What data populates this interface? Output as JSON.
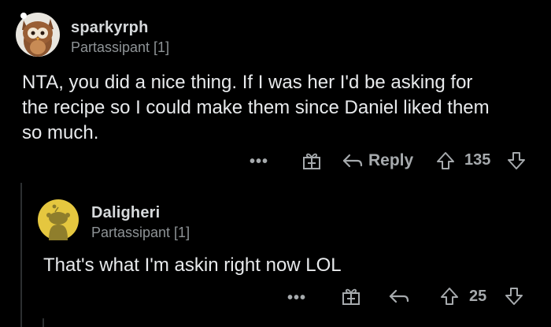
{
  "comments": [
    {
      "username": "sparkyrph",
      "flair": "Partassipant [1]",
      "body_lines": [
        "NTA, you did a nice thing. If I was her I'd be asking for",
        "the recipe so I could make them since Daniel liked them",
        "so much."
      ],
      "actions": {
        "more": "•••",
        "reply": "Reply",
        "score": "135"
      }
    },
    {
      "username": "Daligheri",
      "flair": "Partassipant [1]",
      "body_lines": [
        "That's what I'm askin right now LOL"
      ],
      "actions": {
        "more": "•••",
        "score": "25"
      }
    }
  ],
  "icons": {
    "award": "gift-award-icon",
    "reply": "reply-arrow-icon",
    "upvote": "upvote-arrow-icon",
    "downvote": "downvote-arrow-icon"
  },
  "colors": {
    "background": "#000000",
    "text": "#d7dadc",
    "muted": "#8e9396",
    "action": "#a6aaad",
    "avatar_yellow": "#e5c73f"
  }
}
